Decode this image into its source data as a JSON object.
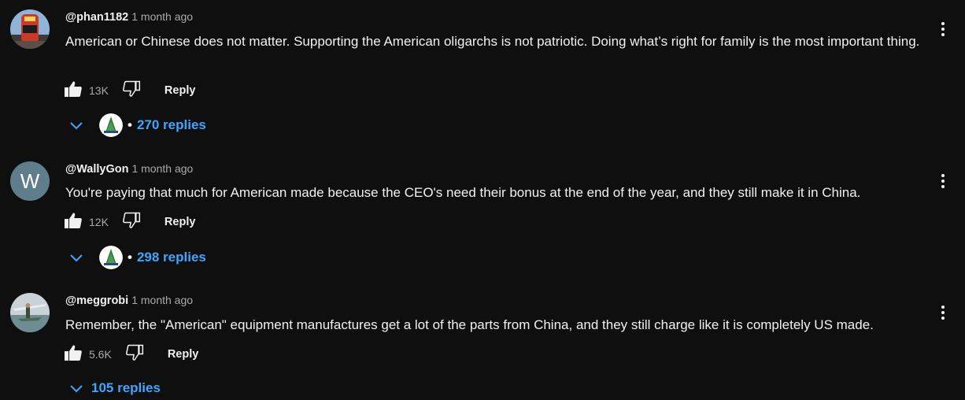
{
  "comments": [
    {
      "handle": "@phan1182",
      "time": "1 month ago",
      "text": "American or Chinese does not matter.  Supporting the American oligarchs is not patriotic.  Doing what’s right for family is the most important thing.",
      "likes": "13K",
      "reply_label": "Reply",
      "replies_label": "270 replies"
    },
    {
      "avatar_letter": "W",
      "handle": "@WallyGon",
      "time": "1 month ago",
      "text": "You're paying that much for American made because the CEO's need their bonus at the end of the year, and they still make it in China.",
      "likes": "12K",
      "reply_label": "Reply",
      "replies_label": "298 replies"
    },
    {
      "handle": "@meggrobi",
      "time": "1 month ago",
      "text": "Remember, the \"American\" equipment manufactures get a lot of the parts from China, and they still charge like it is completely US made.",
      "likes": "5.6K",
      "reply_label": "Reply",
      "replies_label": "105 replies"
    }
  ],
  "icons": {
    "like": "thumbs-up-icon",
    "dislike": "thumbs-down-icon",
    "expand": "chevron-down-icon",
    "more": "more-vert-icon"
  },
  "colors": {
    "background": "#0f0f0f",
    "link": "#3ea6ff",
    "secondary_text": "#aaaaaa"
  }
}
